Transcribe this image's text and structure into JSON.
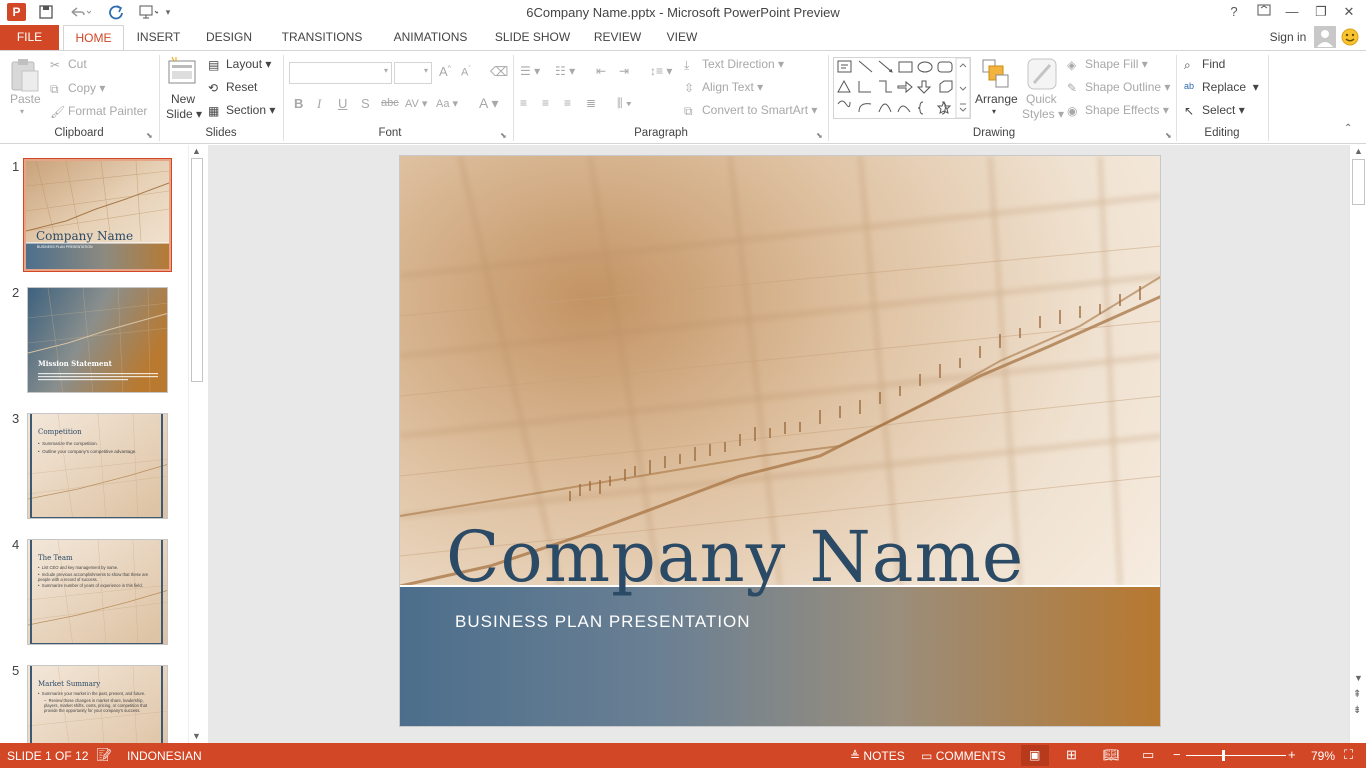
{
  "window": {
    "title": "6Company Name.pptx - Microsoft PowerPoint Preview",
    "help": "?",
    "sign_in": "Sign in"
  },
  "tabs": [
    "FILE",
    "HOME",
    "INSERT",
    "DESIGN",
    "TRANSITIONS",
    "ANIMATIONS",
    "SLIDE SHOW",
    "REVIEW",
    "VIEW"
  ],
  "ribbon": {
    "clipboard": {
      "label": "Clipboard",
      "paste": "Paste",
      "cut": "Cut",
      "copy": "Copy",
      "format_painter": "Format Painter"
    },
    "slides": {
      "label": "Slides",
      "new_slide_1": "New",
      "new_slide_2": "Slide",
      "layout": "Layout",
      "reset": "Reset",
      "section": "Section"
    },
    "font": {
      "label": "Font",
      "font_name": "",
      "font_size": ""
    },
    "paragraph": {
      "label": "Paragraph",
      "text_direction": "Text Direction",
      "align_text": "Align Text",
      "convert_smartart": "Convert to SmartArt"
    },
    "drawing": {
      "label": "Drawing",
      "arrange": "Arrange",
      "quick_styles_1": "Quick",
      "quick_styles_2": "Styles",
      "shape_fill": "Shape Fill",
      "shape_outline": "Shape Outline",
      "shape_effects": "Shape Effects"
    },
    "editing": {
      "label": "Editing",
      "find": "Find",
      "replace": "Replace",
      "select": "Select"
    }
  },
  "thumbnails": [
    {
      "num": "1",
      "title": "Company Name",
      "subtitle": "BUSINESS PLAN PRESENTATION"
    },
    {
      "num": "2",
      "title": "Mission Statement",
      "subtitle": ""
    },
    {
      "num": "3",
      "title": "Competition",
      "bullets": [
        "Summarize the competition.",
        "Outline your company's competitive advantage."
      ]
    },
    {
      "num": "4",
      "title": "The Team",
      "bullets": [
        "List CEO and key management by name.",
        "Include previous accomplishments to show that these are people with a record of success.",
        "Summarize number of years of experience in this field."
      ]
    },
    {
      "num": "5",
      "title": "Market Summary",
      "bullets": [
        "Summarize your market in the past, present, and future.",
        "Review those changes in market share, leadership, players, market shifts, costs, pricing, or competition that provide the opportunity for your company's success."
      ]
    }
  ],
  "slide": {
    "title": "Company Name",
    "subtitle": "BUSINESS PLAN PRESENTATION"
  },
  "status": {
    "slide_info": "SLIDE 1 OF 12",
    "language": "INDONESIAN",
    "notes": "NOTES",
    "comments": "COMMENTS",
    "zoom": "79%"
  },
  "colors": {
    "accent": "#d24726",
    "title_blue": "#2b4a66"
  }
}
